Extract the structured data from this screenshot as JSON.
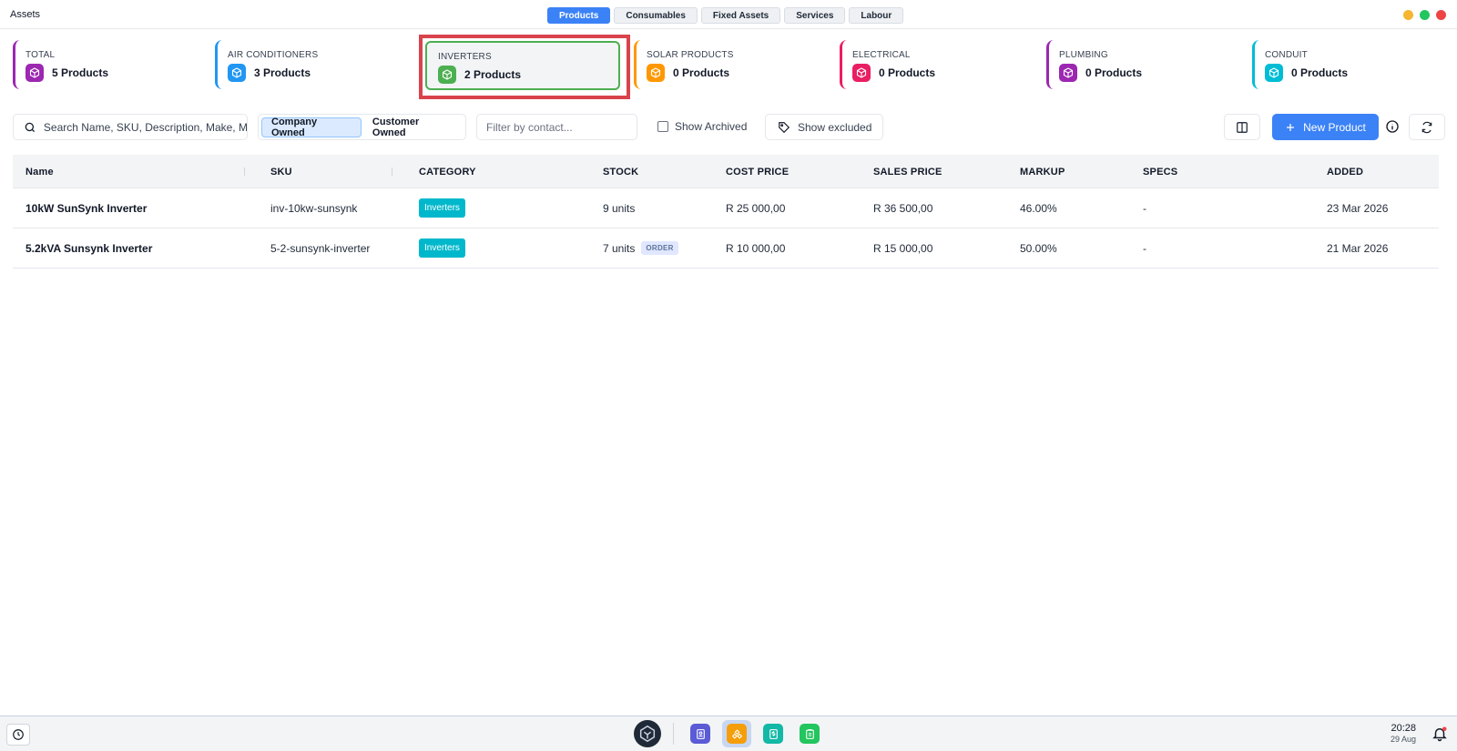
{
  "window": {
    "title": "Assets",
    "tabs": [
      {
        "label": "Products",
        "active": true
      },
      {
        "label": "Consumables",
        "active": false
      },
      {
        "label": "Fixed Assets",
        "active": false
      },
      {
        "label": "Services",
        "active": false
      },
      {
        "label": "Labour",
        "active": false
      }
    ],
    "traffic_colors": [
      "#f5b731",
      "#22c55e",
      "#ef4444"
    ]
  },
  "categories": [
    {
      "label": "TOTAL",
      "value": "5 Products",
      "color": "#9c27b0"
    },
    {
      "label": "AIR CONDITIONERS",
      "value": "3 Products",
      "color": "#2196f3"
    },
    {
      "label": "INVERTERS",
      "value": "2 Products",
      "color": "#4caf50",
      "selected": true
    },
    {
      "label": "SOLAR PRODUCTS",
      "value": "0 Products",
      "color": "#ff9800"
    },
    {
      "label": "ELECTRICAL",
      "value": "0 Products",
      "color": "#e91e63"
    },
    {
      "label": "PLUMBING",
      "value": "0 Products",
      "color": "#9c27b0"
    },
    {
      "label": "CONDUIT",
      "value": "0 Products",
      "color": "#00bcd4"
    }
  ],
  "toolbar": {
    "search_placeholder": "Search Name, SKU, Description, Make, Model...",
    "ownership": [
      {
        "label": "Company Owned",
        "active": true
      },
      {
        "label": "Customer Owned",
        "active": false
      }
    ],
    "contact_placeholder": "Filter by contact...",
    "show_archived": "Show Archived",
    "show_excluded": "Show excluded",
    "new_product": "New Product"
  },
  "table": {
    "columns": [
      "Name",
      "SKU",
      "CATEGORY",
      "STOCK",
      "COST PRICE",
      "SALES PRICE",
      "MARKUP",
      "SPECS",
      "ADDED"
    ],
    "rows": [
      {
        "name": "10kW SunSynk Inverter",
        "sku": "inv-10kw-sunsynk",
        "category": "Inverters",
        "stock": "9 units",
        "badge": "",
        "cost": "R 25 000,00",
        "sales": "R 36 500,00",
        "markup": "46.00%",
        "specs": "-",
        "added": "23 Mar 2026"
      },
      {
        "name": "5.2kVA Sunsynk Inverter",
        "sku": "5-2-sunsynk-inverter",
        "category": "Inverters",
        "stock": "7 units",
        "badge": "ORDER",
        "cost": "R 10 000,00",
        "sales": "R 15 000,00",
        "markup": "50.00%",
        "specs": "-",
        "added": "21 Mar 2026"
      }
    ]
  },
  "taskbar": {
    "time": "20:28",
    "date": "29 Aug",
    "apps": [
      {
        "name": "contacts-app-icon",
        "color": "#5b5bd6",
        "active": false
      },
      {
        "name": "assets-app-icon",
        "color": "#f59e0b",
        "active": true
      },
      {
        "name": "invoices-app-icon",
        "color": "#14b8a6",
        "active": false
      },
      {
        "name": "tasks-app-icon",
        "color": "#22c55e",
        "active": false
      }
    ]
  }
}
